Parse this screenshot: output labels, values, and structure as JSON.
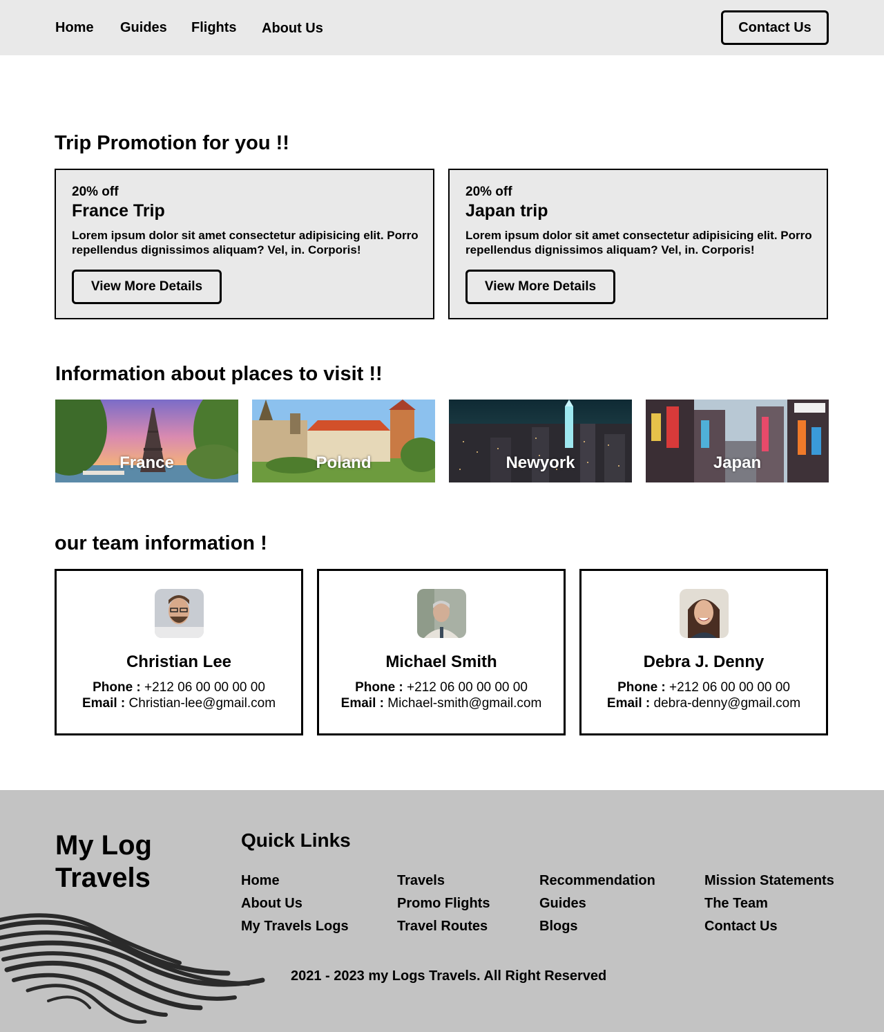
{
  "nav": {
    "links": [
      "Home",
      "Guides",
      "Flights",
      "About Us"
    ],
    "contact_label": "Contact Us"
  },
  "promotions": {
    "title": "Trip Promotion for you !!",
    "cards": [
      {
        "discount": "20% off",
        "title": "France Trip",
        "text": "Lorem ipsum dolor sit amet consectetur adipisicing elit. Porro repellendus dignissimos aliquam? Vel, in. Corporis!",
        "button": "View More Details"
      },
      {
        "discount": "20% off",
        "title": "Japan trip",
        "text": "Lorem ipsum dolor sit amet consectetur adipisicing elit. Porro repellendus dignissimos aliquam? Vel, in. Corporis!",
        "button": "View More Details"
      }
    ]
  },
  "places": {
    "title": "Information about places to visit !!",
    "items": [
      "France",
      "Poland",
      "Newyork",
      "Japan"
    ]
  },
  "team": {
    "title": "our team information !",
    "phone_label": "Phone :",
    "email_label": "Email :",
    "members": [
      {
        "name": "Christian Lee",
        "phone": "+212 06 00 00 00 00",
        "email": "Christian-lee@gmail.com"
      },
      {
        "name": "Michael Smith",
        "phone": "+212 06 00 00 00 00",
        "email": "Michael-smith@gmail.com"
      },
      {
        "name": "Debra J. Denny",
        "phone": "+212 06 00 00 00 00",
        "email": "debra-denny@gmail.com"
      }
    ]
  },
  "footer": {
    "brand": "My Log Travels",
    "quick_links_title": "Quick Links",
    "links": {
      "col1": [
        "Home",
        "About Us",
        "My Travels Logs"
      ],
      "col2": [
        "Travels",
        "Promo Flights",
        "Travel Routes"
      ],
      "col3": [
        "Recommendation",
        "Guides",
        "Blogs"
      ],
      "col4": [
        "Mission Statements",
        "The Team",
        "Contact Us"
      ]
    },
    "copyright": "2021 - 2023 my Logs Travels. All Right Reserved"
  }
}
